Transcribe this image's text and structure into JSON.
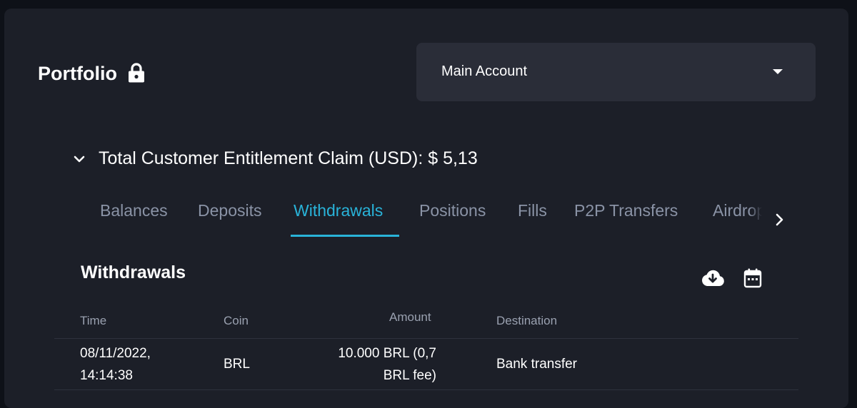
{
  "header": {
    "title": "Portfolio",
    "lock_icon": "lock-icon"
  },
  "account_select": {
    "value": "Main Account",
    "icon": "caret-down-icon"
  },
  "claim": {
    "text": "Total Customer Entitlement Claim (USD): $ 5,13",
    "icon": "chevron-down-icon"
  },
  "tabs": [
    {
      "label": "Balances",
      "active": false
    },
    {
      "label": "Deposits",
      "active": false
    },
    {
      "label": "Withdrawals",
      "active": true
    },
    {
      "label": "Positions",
      "active": false
    },
    {
      "label": "Fills",
      "active": false
    },
    {
      "label": "P2P Transfers",
      "active": false
    },
    {
      "label": "Airdrops",
      "active": false
    }
  ],
  "section": {
    "title": "Withdrawals",
    "actions": [
      "download-icon",
      "calendar-icon"
    ]
  },
  "table": {
    "columns": [
      "Time",
      "Coin",
      "Amount",
      "Destination"
    ],
    "rows": [
      {
        "time_line1": "08/11/2022,",
        "time_line2": "14:14:38",
        "coin": "BRL",
        "amount_line1": "10.000 BRL (0,7",
        "amount_line2": "BRL fee)",
        "destination": "Bank transfer"
      }
    ]
  },
  "colors": {
    "background": "#0e1118",
    "panel": "#1c1f28",
    "select": "#2a2d38",
    "accent": "#29b3d9",
    "muted_text": "#8a93a6"
  }
}
